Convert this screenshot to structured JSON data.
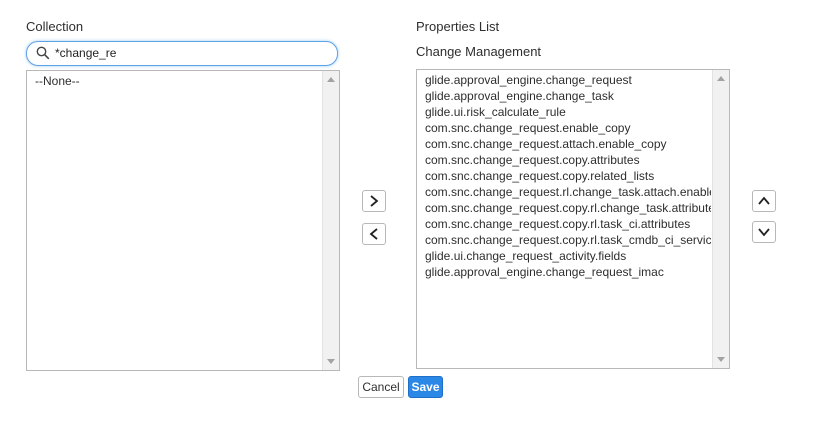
{
  "collection": {
    "label": "Collection",
    "search_value": "*change_re",
    "items": [
      "--None--"
    ]
  },
  "properties": {
    "label": "Properties List",
    "group_label": "Change Management",
    "items": [
      "glide.approval_engine.change_request",
      "glide.approval_engine.change_task",
      "glide.ui.risk_calculate_rule",
      "com.snc.change_request.enable_copy",
      "com.snc.change_request.attach.enable_copy",
      "com.snc.change_request.copy.attributes",
      "com.snc.change_request.copy.related_lists",
      "com.snc.change_request.rl.change_task.attach.enable_copy",
      "com.snc.change_request.copy.rl.change_task.attributes",
      "com.snc.change_request.copy.rl.task_ci.attributes",
      "com.snc.change_request.copy.rl.task_cmdb_ci_service.attributes",
      "glide.ui.change_request_activity.fields",
      "glide.approval_engine.change_request_imac"
    ]
  },
  "buttons": {
    "cancel": "Cancel",
    "save": "Save"
  },
  "icons": {
    "search": "search-icon",
    "add": "chevron-right-icon",
    "remove": "chevron-left-icon",
    "move_up": "chevron-up-icon",
    "move_down": "chevron-down-icon"
  },
  "colors": {
    "accent": "#2b88e6",
    "focus_border": "#5fa3e6"
  }
}
